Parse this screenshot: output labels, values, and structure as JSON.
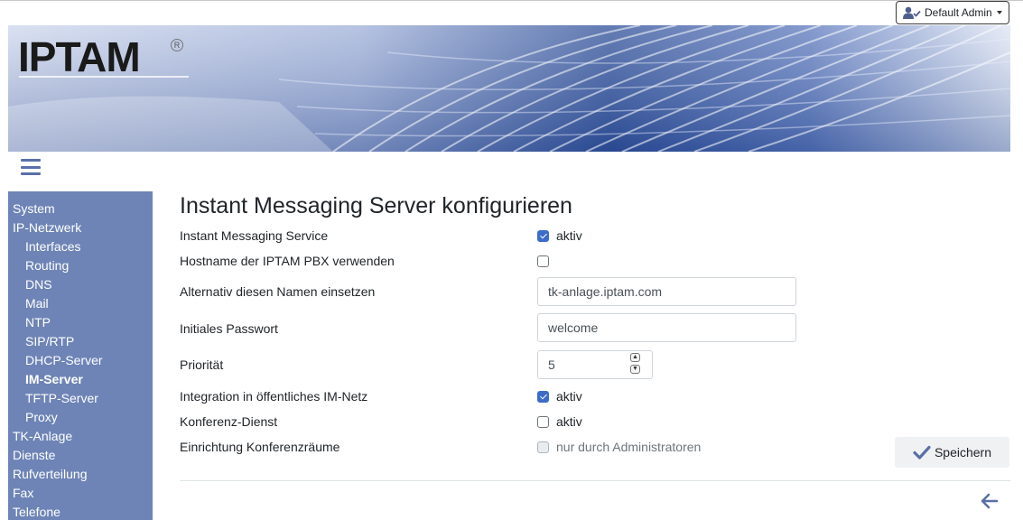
{
  "header": {
    "user_label": "Default Admin",
    "logo_text": "IPTAM",
    "logo_reg": "R"
  },
  "sidebar": {
    "items": [
      {
        "label": "System",
        "level": 0
      },
      {
        "label": "IP-Netzwerk",
        "level": 0
      },
      {
        "label": "Interfaces",
        "level": 1
      },
      {
        "label": "Routing",
        "level": 1
      },
      {
        "label": "DNS",
        "level": 1
      },
      {
        "label": "Mail",
        "level": 1
      },
      {
        "label": "NTP",
        "level": 1
      },
      {
        "label": "SIP/RTP",
        "level": 1
      },
      {
        "label": "DHCP-Server",
        "level": 1
      },
      {
        "label": "IM-Server",
        "level": 1,
        "active": true
      },
      {
        "label": "TFTP-Server",
        "level": 1
      },
      {
        "label": "Proxy",
        "level": 1
      },
      {
        "label": "TK-Anlage",
        "level": 0
      },
      {
        "label": "Dienste",
        "level": 0
      },
      {
        "label": "Rufverteilung",
        "level": 0
      },
      {
        "label": "Fax",
        "level": 0
      },
      {
        "label": "Telefone",
        "level": 0
      }
    ]
  },
  "main": {
    "title": "Instant Messaging Server konfigurieren",
    "fields": {
      "im_service": {
        "label": "Instant Messaging Service",
        "checked": true,
        "option_label": "aktiv"
      },
      "use_hostname": {
        "label": "Hostname der IPTAM PBX verwenden",
        "checked": false
      },
      "alt_name": {
        "label": "Alternativ diesen Namen einsetzen",
        "value": "tk-anlage.iptam.com"
      },
      "initial_password": {
        "label": "Initiales Passwort",
        "value": "welcome"
      },
      "priority": {
        "label": "Priorität",
        "value": "5"
      },
      "public_im": {
        "label": "Integration in öffentliches IM-Netz",
        "checked": true,
        "option_label": "aktiv"
      },
      "conference": {
        "label": "Konferenz-Dienst",
        "checked": false,
        "option_label": "aktiv"
      },
      "conference_rooms": {
        "label": "Einrichtung Konferenzräume",
        "checked": false,
        "disabled": true,
        "option_label": "nur durch Administratoren"
      }
    },
    "save_label": "Speichern"
  },
  "colors": {
    "sidebar_bg": "#6e84b6",
    "accent": "#5a6fa8",
    "checkbox_checked": "#3d6cc8"
  }
}
